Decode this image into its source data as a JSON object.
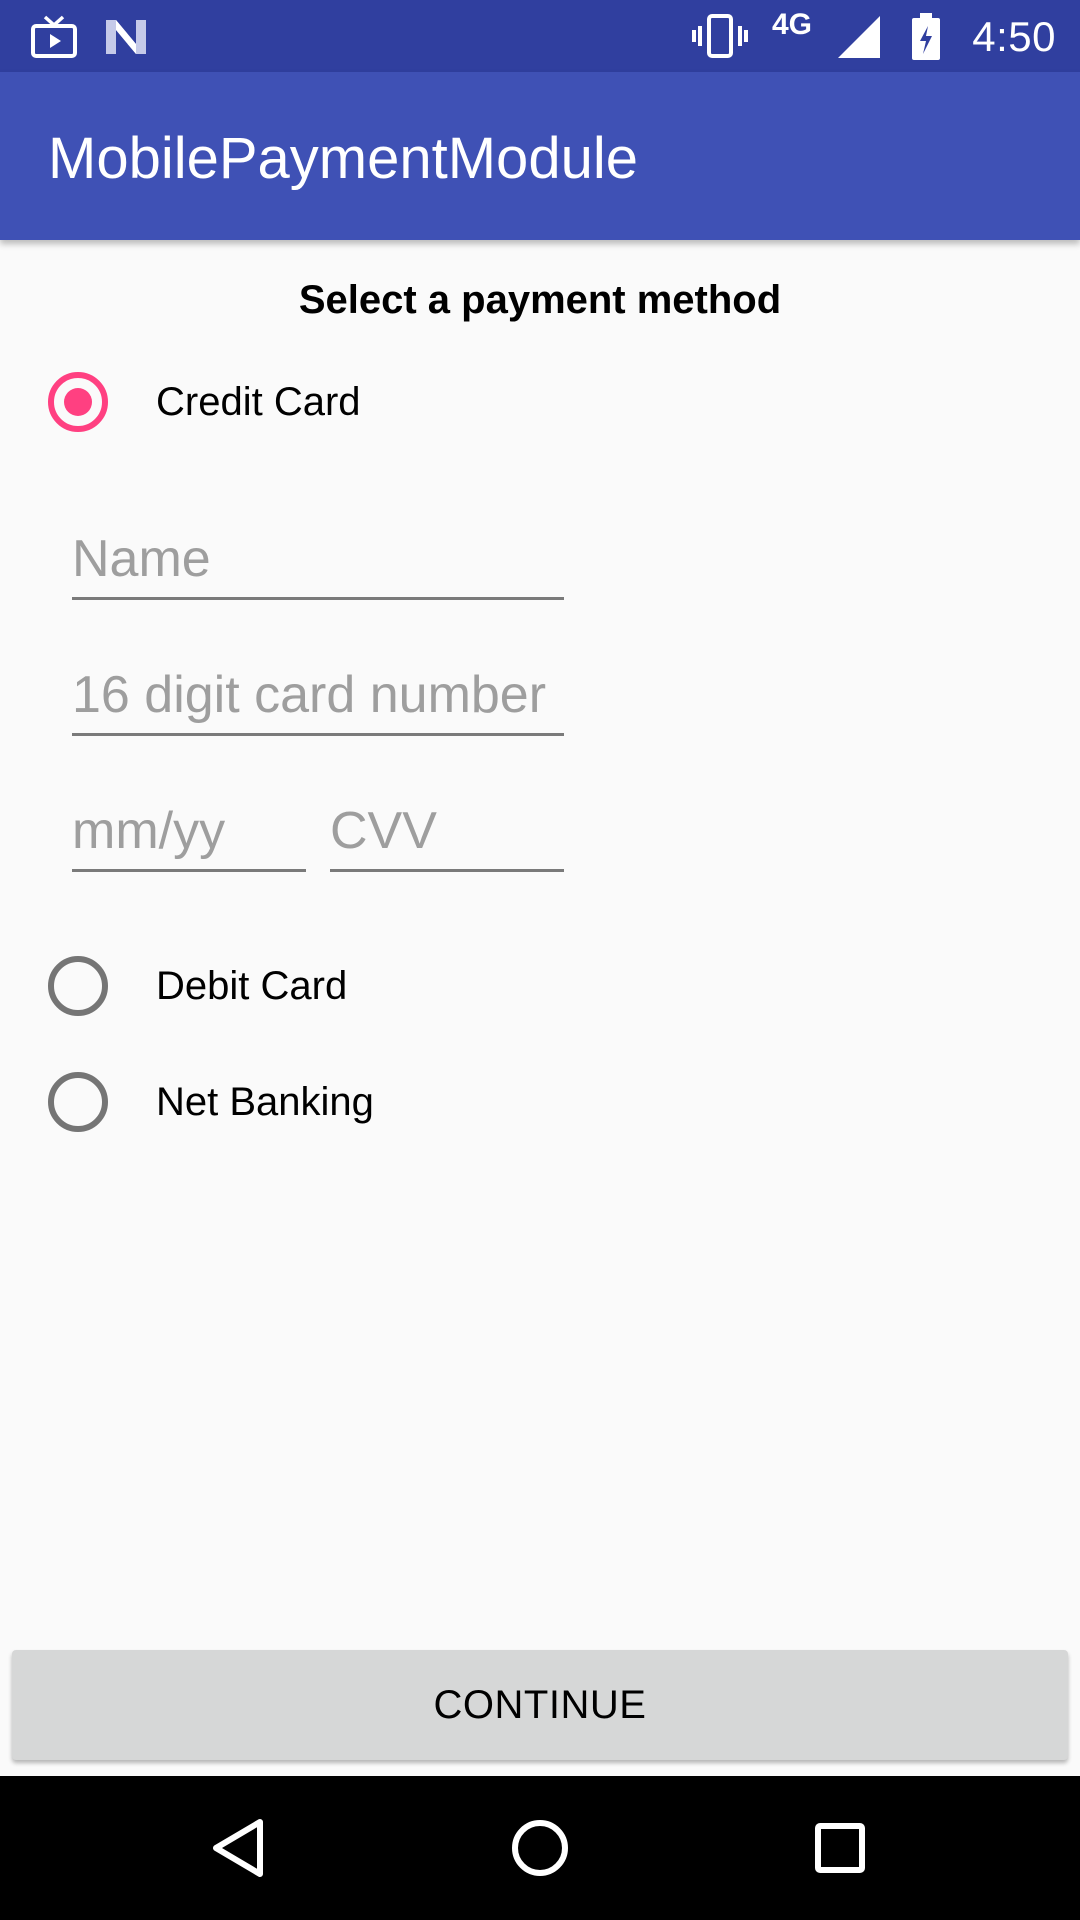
{
  "status_bar": {
    "time": "4:50",
    "network": "4G",
    "background_color": "#303f9f",
    "icons": [
      "tv-icon",
      "notification-n-icon",
      "vibrate-icon",
      "signal-icon",
      "battery-charging-icon"
    ]
  },
  "app_bar": {
    "title": "MobilePaymentModule",
    "background_color": "#3f51b5"
  },
  "payment": {
    "heading": "Select a payment method",
    "accent_color": "#ff4081",
    "options": [
      {
        "label": "Credit Card",
        "selected": true
      },
      {
        "label": "Debit Card",
        "selected": false
      },
      {
        "label": "Net Banking",
        "selected": false
      }
    ],
    "card_form": {
      "name_placeholder": "Name",
      "name_value": "",
      "number_placeholder": "16 digit card number",
      "number_value": "",
      "expiry_placeholder": "mm/yy",
      "expiry_value": "",
      "cvv_placeholder": "CVV",
      "cvv_value": ""
    }
  },
  "continue_button": {
    "label": "CONTINUE"
  },
  "nav_bar": {
    "icons": [
      "back-icon",
      "home-icon",
      "recents-icon"
    ]
  }
}
